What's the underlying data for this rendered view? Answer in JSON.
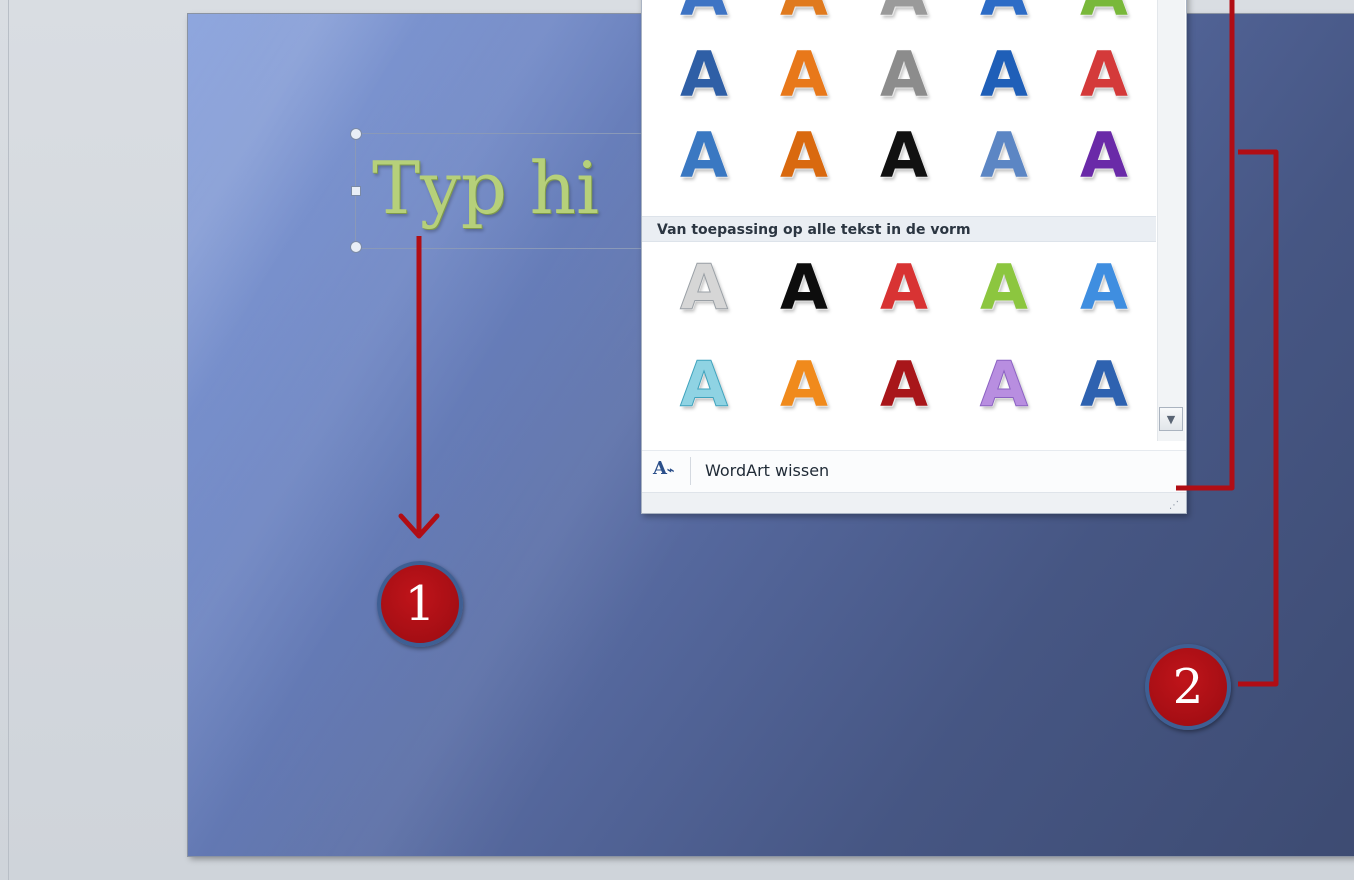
{
  "slide": {
    "title_placeholder": "Typ hi"
  },
  "gallery": {
    "rows_top": [
      {
        "colors": [
          "#3e74c4",
          "#e07a1e",
          "#9a9a9a",
          "#2d6cc6",
          "#79b83a"
        ]
      },
      {
        "colors": [
          "#2f5fa6",
          "#e8781a",
          "#8c8c8c",
          "#1f5fb8",
          "#d43a3a"
        ]
      },
      {
        "colors": [
          "#3a78c2",
          "#d9690f",
          "#111111",
          "#5c86c4",
          "#6a2aa8"
        ]
      }
    ],
    "section_header": "Van toepassing op alle tekst in de vorm",
    "rows_bottom": [
      {
        "colors": [
          "#d6d6d6",
          "#0d0d0d",
          "#d83333",
          "#8cc63f",
          "#3f8ee0"
        ]
      },
      {
        "colors": [
          "#8fd3e3",
          "#f08a1c",
          "#a8161a",
          "#b88ee0",
          "#2e62b0"
        ]
      }
    ],
    "glyph": "A",
    "clear_label": "WordArt wissen",
    "clear_icon_glyph": "A",
    "scroll_arrow": "▼",
    "grip": "⋰"
  },
  "callouts": [
    {
      "label": "1"
    },
    {
      "label": "2"
    }
  ],
  "colors": {
    "callout_red": "#b10d14",
    "callout_ring": "#3f5f93",
    "slide_blue": "#56699f"
  }
}
